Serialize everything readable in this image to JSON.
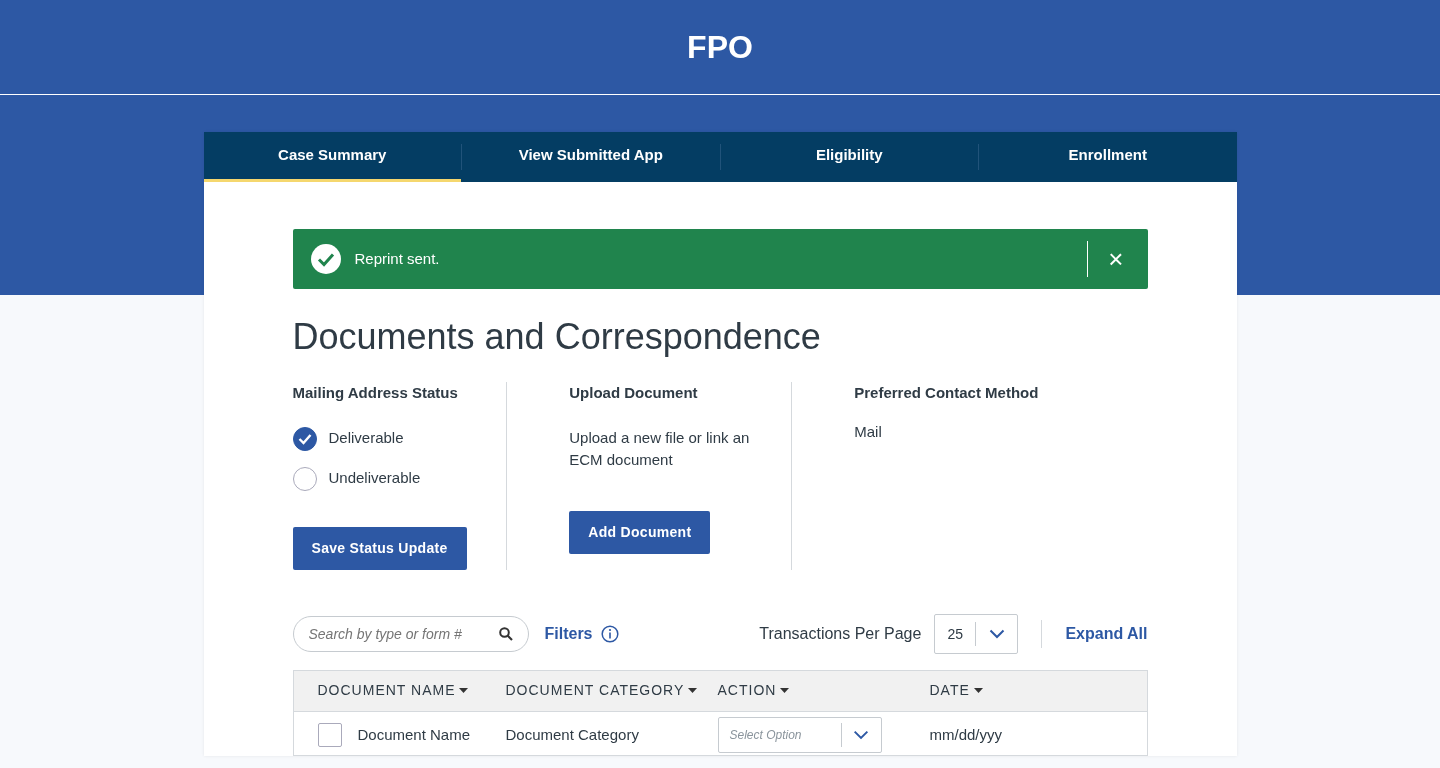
{
  "header": {
    "title": "FPO"
  },
  "tabs": [
    {
      "label": "Case Summary",
      "selected": true
    },
    {
      "label": "View Submitted App",
      "selected": false
    },
    {
      "label": "Eligibility",
      "selected": false
    },
    {
      "label": "Enrollment",
      "selected": false
    }
  ],
  "alert": {
    "kind": "success",
    "message": "Reprint sent.",
    "close": "×"
  },
  "page_title": "Documents and Correspondence",
  "mailing_status": {
    "heading": "Mailing Address Status",
    "options": [
      {
        "label": "Deliverable",
        "selected": true
      },
      {
        "label": "Undeliverable",
        "selected": false
      }
    ],
    "button": "Save Status Update"
  },
  "upload": {
    "heading": "Upload Document",
    "text": "Upload a new file or link an ECM document",
    "button": "Add Document"
  },
  "contact": {
    "heading": "Preferred Contact Method",
    "value": "Mail"
  },
  "toolbar": {
    "search_placeholder": "Search by type or form #",
    "filters": "Filters",
    "per_page_label": "Transactions Per Page",
    "per_page": "25",
    "expand_all": "Expand All"
  },
  "table": {
    "columns": [
      "DOCUMENT NAME",
      "DOCUMENT CATEGORY",
      "ACTION",
      "DATE"
    ],
    "rows": [
      {
        "checked": false,
        "name": "Document Name",
        "category": "Document Category",
        "action_placeholder": "Select Option",
        "date": "mm/dd/yyy"
      }
    ]
  }
}
